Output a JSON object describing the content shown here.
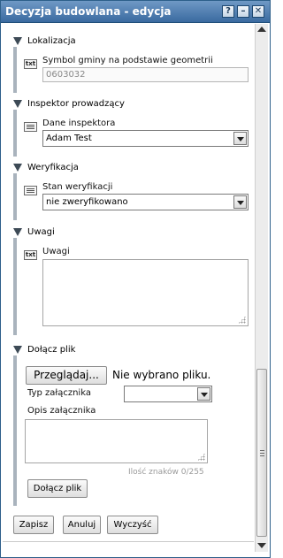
{
  "window": {
    "title": "Decyzja budowlana - edycja",
    "controls": {
      "help": "?",
      "minimize": "–",
      "close": "✕"
    }
  },
  "sections": {
    "lokalizacja": {
      "title": "Lokalizacja",
      "field_icon": "txt",
      "field_label": "Symbol gminy na podstawie geometrii",
      "field_value": "0603032"
    },
    "inspektor": {
      "title": "Inspektor prowadzący",
      "field_label": "Dane inspektora",
      "selected": "Adam Test"
    },
    "weryfikacja": {
      "title": "Weryfikacja",
      "field_label": "Stan weryfikacji",
      "selected": "nie zweryfikowano"
    },
    "uwagi": {
      "title": "Uwagi",
      "field_icon": "txt",
      "field_label": "Uwagi",
      "value": ""
    },
    "plik": {
      "title": "Dołącz plik",
      "browse_label": "Przeglądaj...",
      "no_file_text": "Nie wybrano pliku.",
      "type_label": "Typ załącznika",
      "type_selected": "",
      "desc_label": "Opis załącznika",
      "counter": "Ilość znaków 0/255",
      "attach_label": "Dołącz plik"
    }
  },
  "footer": {
    "save": "Zapisz",
    "cancel": "Anuluj",
    "clear": "Wyczyść"
  },
  "icons": {
    "section_toggle": "triangle-down-icon",
    "text_field": "txt-icon",
    "list_field": "list-icon"
  },
  "colors": {
    "titlebar": "#3a6aa0",
    "section_bar": "#a9b3bd"
  }
}
